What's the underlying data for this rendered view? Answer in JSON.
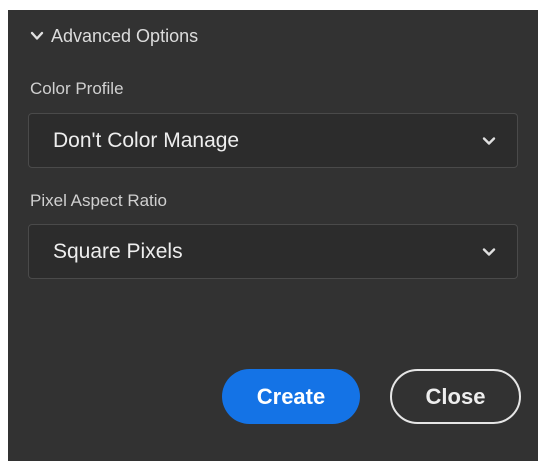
{
  "advanced_options": {
    "header_label": "Advanced Options",
    "header_icon": "chevron-down-icon"
  },
  "color_profile": {
    "label": "Color Profile",
    "selected": "Don't Color Manage",
    "icon": "chevron-down-icon"
  },
  "pixel_aspect_ratio": {
    "label": "Pixel Aspect Ratio",
    "selected": "Square Pixels",
    "icon": "chevron-down-icon"
  },
  "buttons": {
    "create_label": "Create",
    "close_label": "Close"
  },
  "colors": {
    "panel_background": "#323232",
    "accent": "#1473e6"
  }
}
